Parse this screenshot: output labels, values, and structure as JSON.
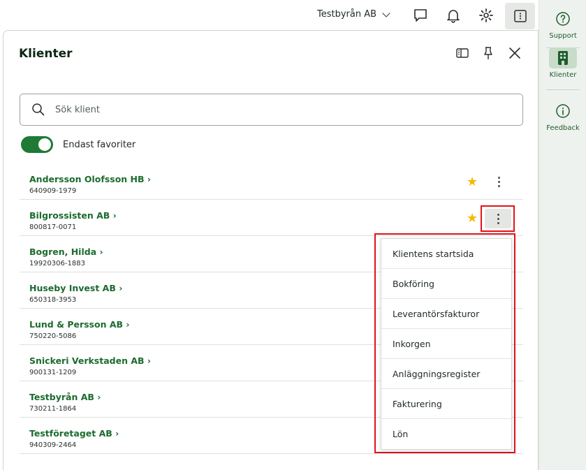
{
  "topbar": {
    "company": "Testbyrån AB"
  },
  "rail": {
    "support": "Support",
    "clients": "Klienter",
    "feedback": "Feedback"
  },
  "panel": {
    "title": "Klienter",
    "search_placeholder": "Sök klient",
    "favorites_toggle_label": "Endast favoriter",
    "favorites_toggle_on": true
  },
  "clients": [
    {
      "name": "Andersson Olofsson HB ›",
      "org": "640909-1979",
      "favorite": true
    },
    {
      "name": "Bilgrossisten AB ›",
      "org": "800817-0071",
      "favorite": true
    },
    {
      "name": "Bogren, Hilda ›",
      "org": "19920306-1883",
      "favorite": false
    },
    {
      "name": "Huseby Invest AB ›",
      "org": "650318-3953",
      "favorite": false
    },
    {
      "name": "Lund & Persson AB ›",
      "org": "750220-5086",
      "favorite": false
    },
    {
      "name": "Snickeri Verkstaden AB ›",
      "org": "900131-1209",
      "favorite": false
    },
    {
      "name": "Testbyrån AB ›",
      "org": "730211-1864",
      "favorite": false
    },
    {
      "name": "Testföretaget AB ›",
      "org": "940309-2464",
      "favorite": false
    }
  ],
  "menu": [
    "Klientens startsida",
    "Bokföring",
    "Leverantörsfakturor",
    "Inkorgen",
    "Anläggningsregister",
    "Fakturering",
    "Lön"
  ],
  "colors": {
    "brand": "#1c6b2e",
    "toggle": "#1e7a34",
    "star": "#f2bb00",
    "highlight": "#e0131a"
  }
}
